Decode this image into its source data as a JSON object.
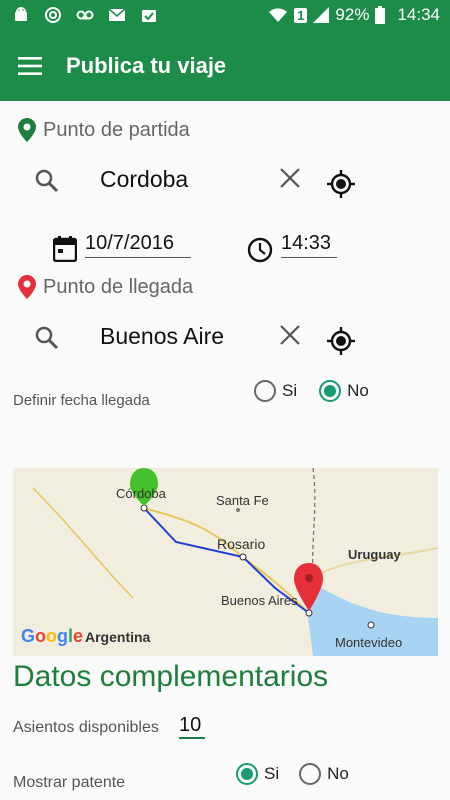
{
  "status_bar": {
    "battery": "92%",
    "time": "14:34",
    "sim": "1",
    "icons": [
      "android-icon",
      "sync-icon",
      "voicemail-icon",
      "mail-icon",
      "clipboard-icon",
      "wifi-icon",
      "signal-icon",
      "battery-icon"
    ]
  },
  "app_bar": {
    "title": "Publica tu viaje",
    "menu_icon": "hamburger-menu-icon"
  },
  "origin": {
    "label": "Punto de partida",
    "value": "Cordoba",
    "date": "10/7/2016",
    "time": "14:33",
    "pin_color": "#1e7e3e"
  },
  "destination": {
    "label": "Punto de llegada",
    "value": "Buenos Aire",
    "pin_color": "#e5303a"
  },
  "arrival_date": {
    "label": "Definir fecha llegada",
    "options": [
      "Si",
      "No"
    ],
    "selected": "No"
  },
  "map": {
    "labels": [
      "Córdoba",
      "Santa Fe",
      "Rosario",
      "Uruguay",
      "Buenos Aires",
      "Montevideo",
      "Argentina"
    ],
    "logo": "Google",
    "route_color": "#1f3fd6"
  },
  "complementary": {
    "heading": "Datos complementarios",
    "seats_label": "Asientos disponibles",
    "seats_value": "10",
    "plate_label": "Mostrar patente",
    "plate_options": [
      "Si",
      "No"
    ],
    "plate_selected": "Si"
  },
  "colors": {
    "primary": "#1e8c49",
    "accent": "#1a9a73"
  }
}
